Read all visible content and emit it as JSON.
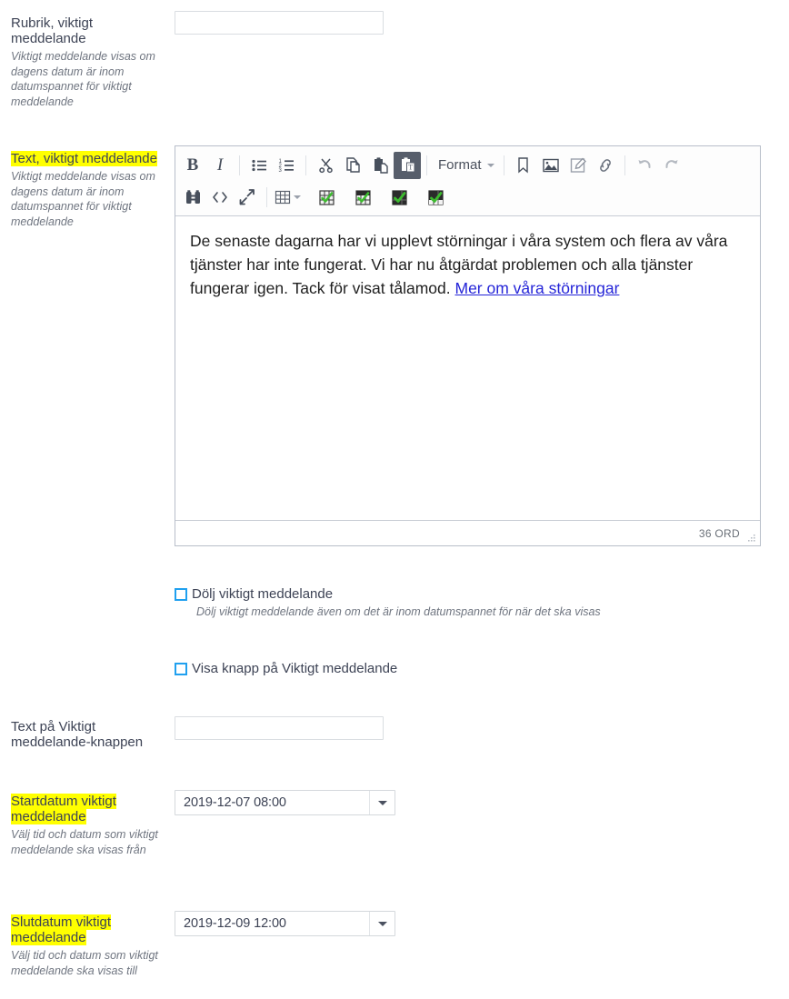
{
  "form": {
    "fields": [
      {
        "id": "rubrik",
        "label": "Rubrik, viktigt meddelande",
        "label_highlighted": false,
        "help": "Viktigt meddelande visas om dagens datum är inom datumspannet för viktigt meddelande",
        "value": "",
        "placeholder": ""
      },
      {
        "id": "text",
        "label_part_highlighted": "Text, viktigt meddelande",
        "label": "Text, viktigt meddelande",
        "label_highlighted": true,
        "help": "Viktigt meddelande visas om dagens datum är inom datumspannet för viktigt meddelande"
      },
      {
        "id": "knapptext",
        "label": "Text på Viktigt meddelande-knappen",
        "label_highlighted": false,
        "help": "",
        "value": "",
        "placeholder": ""
      },
      {
        "id": "startdatum",
        "label": "Startdatum viktigt meddelande",
        "label_highlighted": true,
        "help": "Välj tid och datum som viktigt meddelande ska visas från",
        "value": "2019-12-07 08:00"
      },
      {
        "id": "slutdatum",
        "label": "Slutdatum viktigt meddelande",
        "label_highlighted": true,
        "help": "Välj tid och datum som viktigt meddelande ska visas till",
        "value": "2019-12-09 12:00"
      }
    ],
    "checkboxes": [
      {
        "id": "dolj",
        "label": "Dölj viktigt meddelande",
        "help": "Dölj viktigt meddelande även om det är inom datumspannet för när det ska visas",
        "checked": false
      },
      {
        "id": "visa-knapp",
        "label": "Visa knapp på Viktigt meddelande",
        "help": "",
        "checked": false
      }
    ]
  },
  "editor": {
    "toolbar": {
      "row1": [
        {
          "name": "bold-icon",
          "label": "B",
          "kind": "bold"
        },
        {
          "name": "italic-icon",
          "label": "I",
          "kind": "italic"
        },
        {
          "name": "separator",
          "kind": "sep"
        },
        {
          "name": "bulleted-list-icon",
          "kind": "ul"
        },
        {
          "name": "numbered-list-icon",
          "kind": "ol"
        },
        {
          "name": "separator",
          "kind": "sep"
        },
        {
          "name": "cut-scissors-icon",
          "kind": "cut"
        },
        {
          "name": "copy-icon",
          "kind": "copy"
        },
        {
          "name": "paste-icon",
          "kind": "paste"
        },
        {
          "name": "paste-from-word-icon",
          "kind": "paste-word",
          "active": true
        },
        {
          "name": "separator",
          "kind": "sep"
        },
        {
          "name": "format-dropdown",
          "label": "Format",
          "kind": "format"
        },
        {
          "name": "separator",
          "kind": "sep"
        },
        {
          "name": "anchor-bookmark-icon",
          "kind": "anchor"
        },
        {
          "name": "image-icon",
          "kind": "image"
        },
        {
          "name": "edit-source-icon",
          "kind": "editsrc"
        },
        {
          "name": "link-icon",
          "kind": "link"
        },
        {
          "name": "separator",
          "kind": "sep"
        },
        {
          "name": "undo-icon",
          "kind": "undo",
          "disabled": true
        },
        {
          "name": "redo-icon",
          "kind": "redo",
          "disabled": true
        }
      ],
      "row2": [
        {
          "name": "find-replace-binoculars-icon",
          "kind": "find"
        },
        {
          "name": "source-code-icon",
          "kind": "source"
        },
        {
          "name": "maximize-icon",
          "kind": "maximize"
        },
        {
          "name": "separator",
          "kind": "sep"
        },
        {
          "name": "table-icon",
          "kind": "table",
          "has_caret": true
        },
        {
          "name": "table-check-light-icon",
          "kind": "tablecheck",
          "variant": "light"
        },
        {
          "name": "table-check-header-icon",
          "kind": "tablecheck",
          "variant": "header"
        },
        {
          "name": "table-check-dark-icon",
          "kind": "tablecheck",
          "variant": "dark"
        },
        {
          "name": "table-check-mixed-icon",
          "kind": "tablecheck",
          "variant": "mixed"
        }
      ],
      "format_label": "Format"
    },
    "content": {
      "paragraph_before_link": "De senaste dagarna har vi upplevt störningar i våra system och flera av våra tjänster har inte fungerat. Vi har nu åtgärdat problemen och alla tjänster fungerar igen. Tack för visat tålamod. ",
      "link_text": "Mer om våra störningar"
    },
    "status": {
      "word_count": "36 ORD"
    }
  },
  "colors": {
    "highlight": "#ffff00",
    "checkbox_border": "#20a0ef",
    "link": "#2525d8",
    "active_button_bg": "#575e6b",
    "label_text": "#3d4355"
  }
}
